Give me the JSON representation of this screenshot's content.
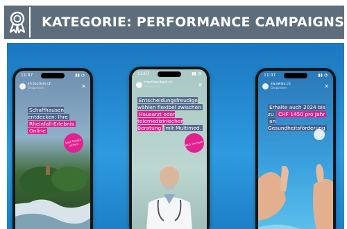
{
  "header": {
    "title": "KATEGORIE: PERFORMANCE CAMPAIGNS",
    "icon": "award-ribbon-icon",
    "background_color": "#5d6d7b"
  },
  "phones": [
    {
      "time": "11:07",
      "account": "sh.tourism.ch",
      "sponsored": "Gesponsert",
      "caption_dark": "Schaffhausen entdecken: Ihre",
      "caption_pink": "Rheinfall-Erlebnis",
      "caption_pink2": "Online",
      "sticker": "Jetzt Tickets sichern"
    },
    {
      "time": "11:07",
      "account": "mw.theulbert.ch",
      "sponsored": "Gesponsert",
      "caption_dark": "Entscheidungsfreudige wählen flexibel zwischen",
      "caption_pink": "Hausarzt oder telemedizinischer Beratung",
      "caption_dark2": "mit Multimed.",
      "sticker": "Jetzt wechseln"
    },
    {
      "time": "11:07",
      "account": "sw.swiss.ch",
      "sponsored": "Gesponsert",
      "caption_dark": "Erhalte auch 2024 bis zu",
      "caption_pink": "CHF 1450 pro Jahr",
      "caption_dark2": "an Gesundheitsförderung"
    }
  ],
  "colors": {
    "accent_pink": "#e3208f",
    "stage_blue": "#1a78c0"
  }
}
